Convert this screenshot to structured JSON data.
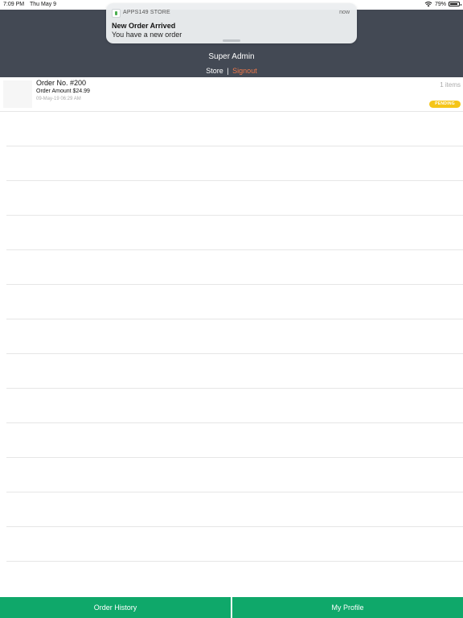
{
  "status_bar": {
    "time": "7:09 PM",
    "date": "Thu May 9",
    "battery": "79%",
    "wifi_icon": "wifi-icon",
    "battery_icon": "battery-icon"
  },
  "notification": {
    "app_name": "APPS149 STORE",
    "time": "now",
    "title": "New Order Arrived",
    "body": "You have a new order"
  },
  "header": {
    "title": "Super Admin",
    "store_link": "Store",
    "separator": "|",
    "signout_link": "Signout",
    "background_color": "#434954",
    "signout_color": "#f0784a"
  },
  "orders": [
    {
      "number": "Order No. #200",
      "amount": "Order Amount $24.99",
      "date": "09-May-19 06:29 AM",
      "items": "1 items",
      "status": "PENDING",
      "status_color": "#f5c518"
    }
  ],
  "tabbar": {
    "tabs": [
      {
        "label": "Order History"
      },
      {
        "label": "My Profile"
      }
    ],
    "background_color": "#0fa86a"
  }
}
